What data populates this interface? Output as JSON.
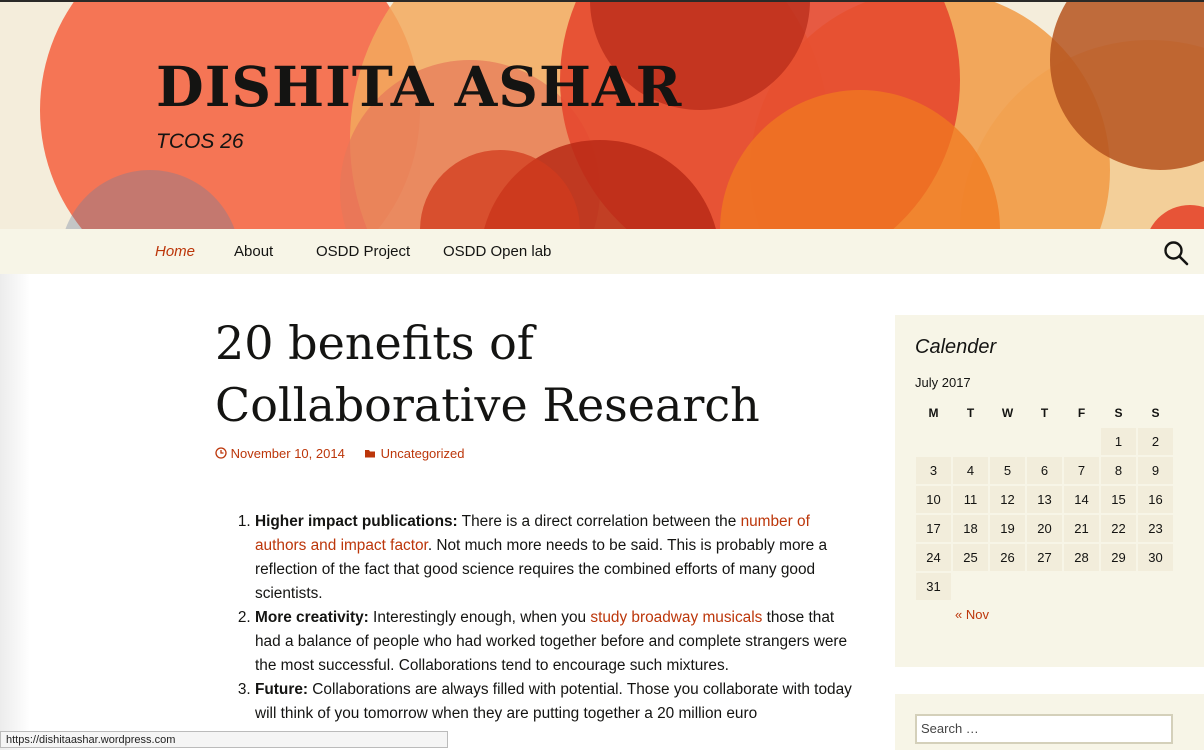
{
  "site": {
    "title": "DISHITA ASHAR",
    "description": "TCOS 26"
  },
  "nav": {
    "items": [
      {
        "label": "Home",
        "active": true
      },
      {
        "label": "About"
      },
      {
        "label": "OSDD Project"
      },
      {
        "label": "OSDD Open lab"
      }
    ]
  },
  "post": {
    "title_line1": "20 benefits of",
    "title_line2": "Collaborative  Research",
    "date": "November 10, 2014",
    "category": "Uncategorized",
    "items": [
      {
        "bold": "Higher impact publications:",
        "text1": " There is a direct correlation between the ",
        "link": "number of authors and impact factor",
        "text2": ". Not much more needs to be said. This is probably more a reflection of the fact that good science requires the combined efforts of many good scientists."
      },
      {
        "bold": "More creativity:",
        "text1": "  Interestingly enough, when you ",
        "link": "study broadway musicals",
        "text2": " those that had a balance of people who had worked together before and complete strangers were the most successful. Collaborations tend to encourage such mixtures."
      },
      {
        "bold": "Future:",
        "text1": " Collaborations are always filled with potential. Those you collaborate with today will think of you tomorrow when they are putting together a 20 million euro"
      }
    ]
  },
  "sidebar": {
    "calendar": {
      "title": "Calender",
      "caption": "July 2017",
      "weekdays": [
        "M",
        "T",
        "W",
        "T",
        "F",
        "S",
        "S"
      ],
      "prev": "« Nov"
    },
    "search_placeholder": "Search …"
  },
  "status_bar": "https://dishitaashar.wordpress.com",
  "colors": {
    "accent": "#bc360a",
    "nav_bg": "#f7f5e7",
    "text": "#141412"
  },
  "icons": {
    "search": "search-icon",
    "clock": "clock-icon",
    "folder": "folder-icon"
  }
}
